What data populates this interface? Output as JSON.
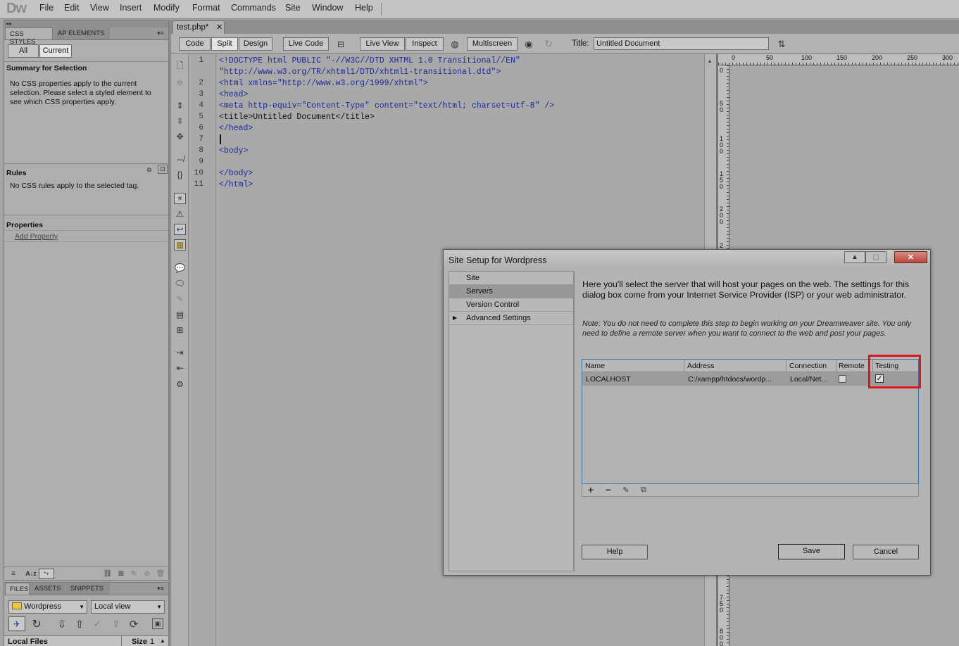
{
  "app": {
    "logo": "Dw",
    "menu": [
      "File",
      "Edit",
      "View",
      "Insert",
      "Modify",
      "Format",
      "Commands",
      "Site",
      "Window",
      "Help"
    ]
  },
  "left_panel": {
    "collapse_glyph": "◂◂",
    "tabs": [
      "CSS STYLES",
      "AP ELEMENTS"
    ],
    "buttons": [
      "All",
      "Current"
    ],
    "summary_title": "Summary for Selection",
    "summary_lines": [
      "No CSS properties apply to the current",
      "selection.  Please select a styled element to",
      "see which CSS properties apply."
    ],
    "rules_title": "Rules",
    "rules_text": "No CSS rules apply to the selected tag.",
    "properties_title": "Properties",
    "add_property": "Add Property",
    "bottom_tool_az": "A↓z"
  },
  "files_panel": {
    "tabs": [
      "FILES",
      "ASSETS",
      "SNIPPETS"
    ],
    "site_select": "Wordpress",
    "view_select": "Local view",
    "col_local": "Local Files",
    "col_size": "Size",
    "col_extra": "1"
  },
  "document": {
    "tab_label": "test.php*",
    "toolbar": {
      "code": "Code",
      "split": "Split",
      "design": "Design",
      "live_code": "Live Code",
      "live_view": "Live View",
      "inspect": "Inspect",
      "multiscreen": "Multiscreen",
      "title_label": "Title:",
      "title_value": "Untitled Document"
    },
    "code_lines": [
      "<!DOCTYPE html PUBLIC \"-//W3C//DTD XHTML 1.0 Transitional//EN\"",
      "\"http://www.w3.org/TR/xhtml1/DTD/xhtml1-transitional.dtd\">",
      "<html xmlns=\"http://www.w3.org/1999/xhtml\">",
      "<head>",
      "<meta http-equiv=\"Content-Type\" content=\"text/html; charset=utf-8\" />",
      "<title>Untitled Document</title>",
      "</head>",
      "",
      "<body>",
      "",
      "</body>",
      "</html>"
    ],
    "line_numbers": [
      "1",
      "",
      "2",
      "3",
      "4",
      "5",
      "6",
      "7",
      "8",
      "9",
      "10",
      "11"
    ],
    "ruler_h": [
      "0",
      "50",
      "100",
      "150",
      "200",
      "250",
      "300"
    ],
    "ruler_v": [
      "0",
      "50",
      "100",
      "150",
      "200",
      "2",
      "750",
      "800"
    ]
  },
  "dialog": {
    "title": "Site Setup for Wordpress",
    "nav": [
      "Site",
      "Servers",
      "Version Control",
      "Advanced Settings"
    ],
    "selected_nav": "Servers",
    "intro": "Here you'll select the server that will host your pages on the web. The settings for this dialog box come from your Internet Service Provider (ISP) or your web administrator.",
    "note": "Note: You do not need to complete this step to begin working on your Dreamweaver site. You only need to define a remote server when you want to connect to the web and post your pages.",
    "table": {
      "columns": [
        "Name",
        "Address",
        "Connection",
        "Remote",
        "Testing"
      ],
      "rows": [
        {
          "name": "LOCALHOST",
          "address": "C:/xampp/htdocs/wordp...",
          "connection": "Local/Net...",
          "remote": false,
          "testing": true
        }
      ]
    },
    "buttons": {
      "help": "Help",
      "save": "Save",
      "cancel": "Cancel"
    },
    "highlight_color": "#e0151a"
  }
}
